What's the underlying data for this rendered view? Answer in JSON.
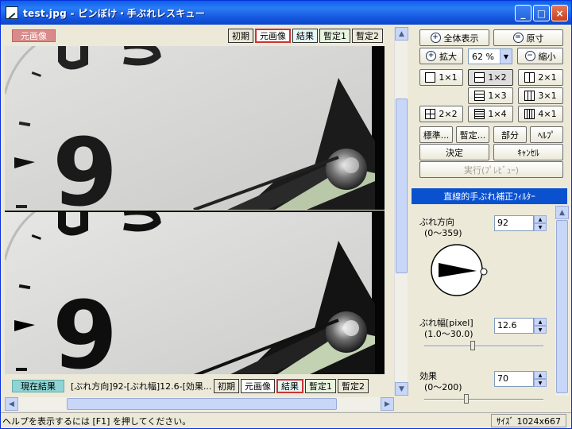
{
  "window": {
    "title": "test.jpg - ピンぼけ・手ぶれレスキュー",
    "minimize": "_",
    "maximize": "□",
    "close": "×"
  },
  "top_view": {
    "label": "元画像",
    "buttons": [
      "初期",
      "元画像",
      "結果",
      "暫定1",
      "暫定2"
    ]
  },
  "bottom_view": {
    "label": "現在結果",
    "info": "[ぶれ方向]92-[ぶれ幅]12.6-[効果...",
    "buttons": [
      "初期",
      "元画像",
      "結果",
      "暫定1",
      "暫定2"
    ]
  },
  "zoom": {
    "fit_all": "全体表示",
    "original_size": "原寸",
    "zoom_in": "拡大",
    "zoom_out": "縮小",
    "zoom_value": "62 %"
  },
  "layouts": {
    "l1x1": "1×1",
    "l1x2": "1×2",
    "l2x1": "2×1",
    "l1x3": "1×3",
    "l3x1": "3×1",
    "l2x2": "2×2",
    "l1x4": "1×4",
    "l4x1": "4×1"
  },
  "actions": {
    "standard": "標準...",
    "provisional": "暫定...",
    "partial": "部分",
    "help": "ﾍﾙﾌﾟ",
    "decide": "決定",
    "cancel": "ｷｬﾝｾﾙ",
    "execute_preview": "実行(ﾌﾟﾚﾋﾞｭｰ)"
  },
  "filter": {
    "title": "直線的手ぶれ補正ﾌｨﾙﾀｰ",
    "direction_label": "ぶれ方向",
    "direction_range": "(0～359)",
    "direction_value": "92",
    "width_label": "ぶれ幅[pixel]",
    "width_range": "(1.0～30.0)",
    "width_value": "12.6",
    "width_fraction": 0.4,
    "effect_label": "効果",
    "effect_range": "(0～200)",
    "effect_value": "70",
    "effect_fraction": 0.35
  },
  "status": {
    "help_text": "ヘルプを表示するには [F1] を押してください。",
    "size": "ｻｲｽﾞ 1024x667"
  },
  "colors": {
    "title_blue": "#0a5fe8",
    "filter_title_bg": "#0a51d0",
    "original_tag": "#d98a8a",
    "result_tag": "#8fd4d4"
  }
}
